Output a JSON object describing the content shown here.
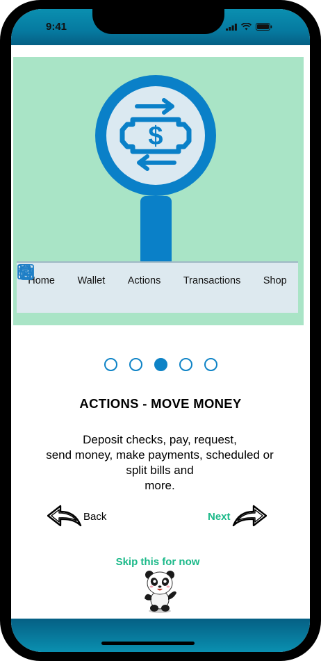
{
  "status_bar": {
    "time": "9:41"
  },
  "hero": {
    "icon": "magnifier-money-exchange-icon",
    "tabs": [
      {
        "label": "Home",
        "icon": "home-icon"
      },
      {
        "label": "Wallet",
        "icon": "wallet-icon"
      },
      {
        "label": "Actions",
        "icon": "money-transfer-icon"
      },
      {
        "label": "Transactions",
        "icon": "receipt-icon"
      },
      {
        "label": "Shop",
        "icon": "cart-icon"
      }
    ]
  },
  "pager": {
    "total": 5,
    "active_index": 2
  },
  "onboarding": {
    "title": "ACTIONS - MOVE MONEY",
    "description_lines": [
      "Deposit checks, pay, request,",
      "send money, make payments, scheduled or",
      "split bills and",
      "more."
    ]
  },
  "nav": {
    "back_label": "Back",
    "next_label": "Next",
    "skip_label": "Skip this for now"
  },
  "colors": {
    "accent_blue": "#0e83c6",
    "accent_green": "#1bb989",
    "hero_bg": "#a9e4c6"
  }
}
